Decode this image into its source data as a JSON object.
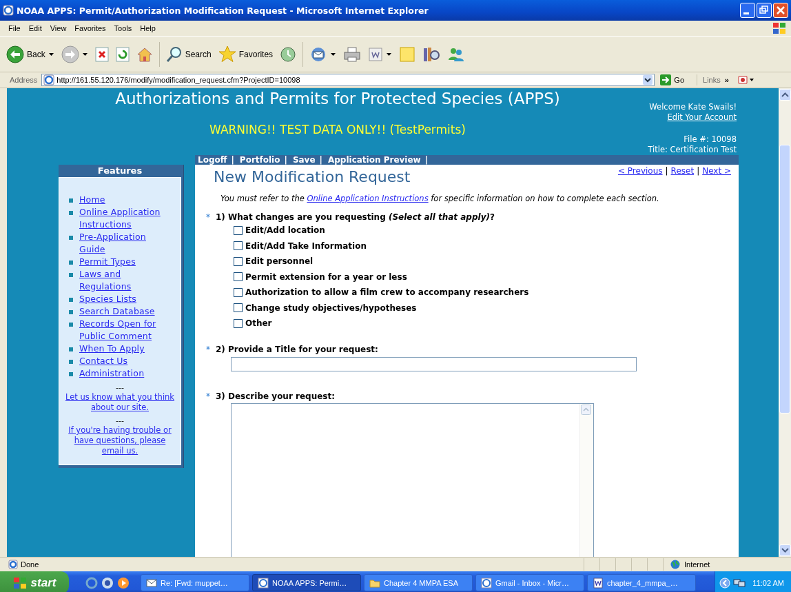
{
  "window": {
    "title": "NOAA APPS: Permit/Authorization Modification Request - Microsoft Internet Explorer"
  },
  "menu": [
    "File",
    "Edit",
    "View",
    "Favorites",
    "Tools",
    "Help"
  ],
  "toolbar": [
    {
      "kind": "back",
      "label": "Back",
      "dropdown": true
    },
    {
      "kind": "forward",
      "dropdown": true
    },
    {
      "kind": "stop"
    },
    {
      "kind": "refresh"
    },
    {
      "kind": "home"
    },
    {
      "kind": "search",
      "label": "Search"
    },
    {
      "kind": "favorites",
      "label": "Favorites"
    },
    {
      "kind": "history"
    },
    {
      "kind": "mail",
      "dropdown": true
    },
    {
      "kind": "print"
    },
    {
      "kind": "word",
      "dropdown": true
    },
    {
      "kind": "note"
    },
    {
      "kind": "research"
    },
    {
      "kind": "messenger"
    }
  ],
  "address": {
    "label": "Address",
    "url": "http://161.55.120.176/modify/modification_request.cfm?ProjectID=10098",
    "go": "Go",
    "links": "Links",
    "more": "»"
  },
  "page": {
    "header": {
      "title": "Authorizations and Permits for Protected Species (APPS)",
      "warning": "WARNING!! TEST DATA ONLY!! (TestPermits)",
      "welcome": "Welcome Kate Swails!",
      "edit_account": "Edit Your Account",
      "file_no": "File #: 10098",
      "file_title": "Title: Certification Test"
    },
    "nav": [
      {
        "kind": "link",
        "text": "Logoff"
      },
      {
        "kind": "sep",
        "text": "|"
      },
      {
        "kind": "link",
        "text": "Portfolio"
      },
      {
        "kind": "sep",
        "text": "|"
      },
      {
        "kind": "link",
        "text": "Save"
      },
      {
        "kind": "sep",
        "text": "|"
      },
      {
        "kind": "link",
        "text": "Application Preview"
      },
      {
        "kind": "sep",
        "text": "|"
      }
    ],
    "sidebar": {
      "heading": "Features",
      "items": [
        "Home",
        "Online Application Instructions",
        "Pre-Application Guide",
        "Permit Types",
        "Laws and Regulations",
        "Species Lists",
        "Search Database",
        "Records Open for Public Comment",
        "When To Apply",
        "Contact Us",
        "Administration"
      ],
      "blocks": [
        {
          "kind": "divider",
          "text": "---"
        },
        {
          "kind": "link",
          "text": "Let us know what you think about our site."
        },
        {
          "kind": "divider",
          "text": "---"
        },
        {
          "kind": "link",
          "text": "If you're having trouble or have questions, please email us."
        }
      ]
    },
    "form": {
      "heading": "New Modification Request",
      "pager": [
        {
          "kind": "link",
          "text": "< Previous"
        },
        {
          "kind": "sep",
          "text": "|"
        },
        {
          "kind": "link",
          "text": "Reset"
        },
        {
          "kind": "sep",
          "text": "|"
        },
        {
          "kind": "link",
          "text": "Next >"
        }
      ],
      "instructions": {
        "before": "You must refer to the",
        "link": "Online Application Instructions",
        "after": "for specific information on how to complete each section."
      },
      "questions": [
        {
          "kind": "checkboxes",
          "mark": "*",
          "label": "1) What changes are you requesting *(Select all that apply)*?",
          "options": [
            {
              "label": "Edit/Add location",
              "checked": false
            },
            {
              "label": "Edit/Add Take Information",
              "checked": false
            },
            {
              "label": "Edit personnel",
              "checked": false
            },
            {
              "label": "Permit extension for a year or less",
              "checked": false
            },
            {
              "label": "Authorization to allow a film crew to accompany researchers",
              "checked": false
            },
            {
              "label": "Change study objectives/hypotheses",
              "checked": false
            },
            {
              "label": "Other",
              "checked": false
            }
          ]
        },
        {
          "kind": "text",
          "mark": "*",
          "label": "2) Provide a Title for your request:"
        },
        {
          "kind": "textarea",
          "mark": "*",
          "label": "3) Describe your request:"
        }
      ]
    }
  },
  "status_bar": {
    "text": "Done",
    "zone": "Internet"
  },
  "taskbar": {
    "start": "start",
    "tasks": [
      {
        "kind": "mail",
        "label": "Re: [Fwd: muppet…",
        "selected": false
      },
      {
        "kind": "ie",
        "label": "NOAA APPS: Permi…",
        "selected": true
      },
      {
        "kind": "folder",
        "label": "Chapter 4 MMPA ESA",
        "selected": false
      },
      {
        "kind": "ie",
        "label": "Gmail - Inbox - Micr…",
        "selected": false
      },
      {
        "kind": "word",
        "label": "chapter_4_mmpa_…",
        "selected": false
      }
    ],
    "clock": "11:02 AM"
  }
}
